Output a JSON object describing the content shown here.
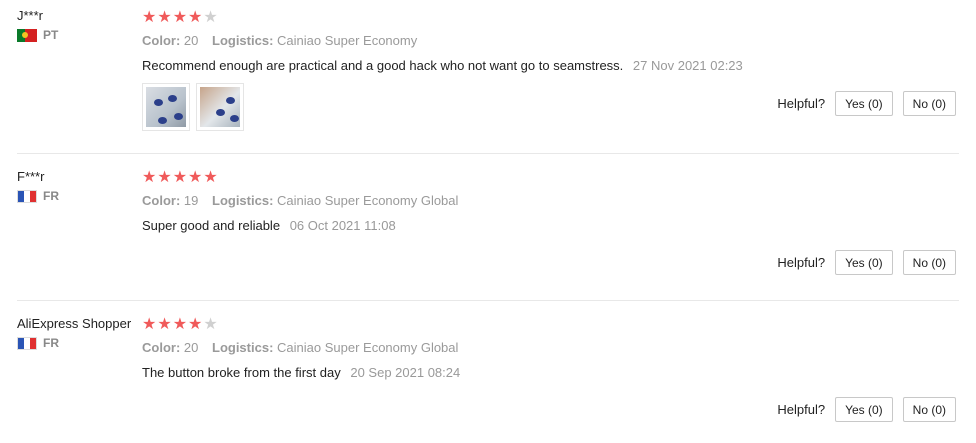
{
  "reviews": [
    {
      "name": "J***r",
      "country": "PT",
      "rating": 4,
      "color_label": "Color:",
      "color_value": "20",
      "logistics_label": "Logistics:",
      "logistics_value": "Cainiao Super Economy",
      "text": "Recommend enough are practical and a good hack who not want go to seamstress.",
      "date": "27 Nov 2021 02:23",
      "photos": 2,
      "helpful_label": "Helpful?",
      "yes_label": "Yes (0)",
      "no_label": "No (0)"
    },
    {
      "name": "F***r",
      "country": "FR",
      "rating": 5,
      "color_label": "Color:",
      "color_value": "19",
      "logistics_label": "Logistics:",
      "logistics_value": "Cainiao Super Economy Global",
      "text": "Super good and reliable",
      "date": "06 Oct 2021 11:08",
      "photos": 0,
      "helpful_label": "Helpful?",
      "yes_label": "Yes (0)",
      "no_label": "No (0)"
    },
    {
      "name": "AliExpress Shopper",
      "country": "FR",
      "rating": 4,
      "color_label": "Color:",
      "color_value": "20",
      "logistics_label": "Logistics:",
      "logistics_value": "Cainiao Super Economy Global",
      "text": "The button broke from the first day",
      "date": "20 Sep 2021 08:24",
      "photos": 0,
      "helpful_label": "Helpful?",
      "yes_label": "Yes (0)",
      "no_label": "No (0)"
    }
  ],
  "colors": {
    "star_on": "#f05a5a",
    "star_off": "#d0d0d0"
  }
}
